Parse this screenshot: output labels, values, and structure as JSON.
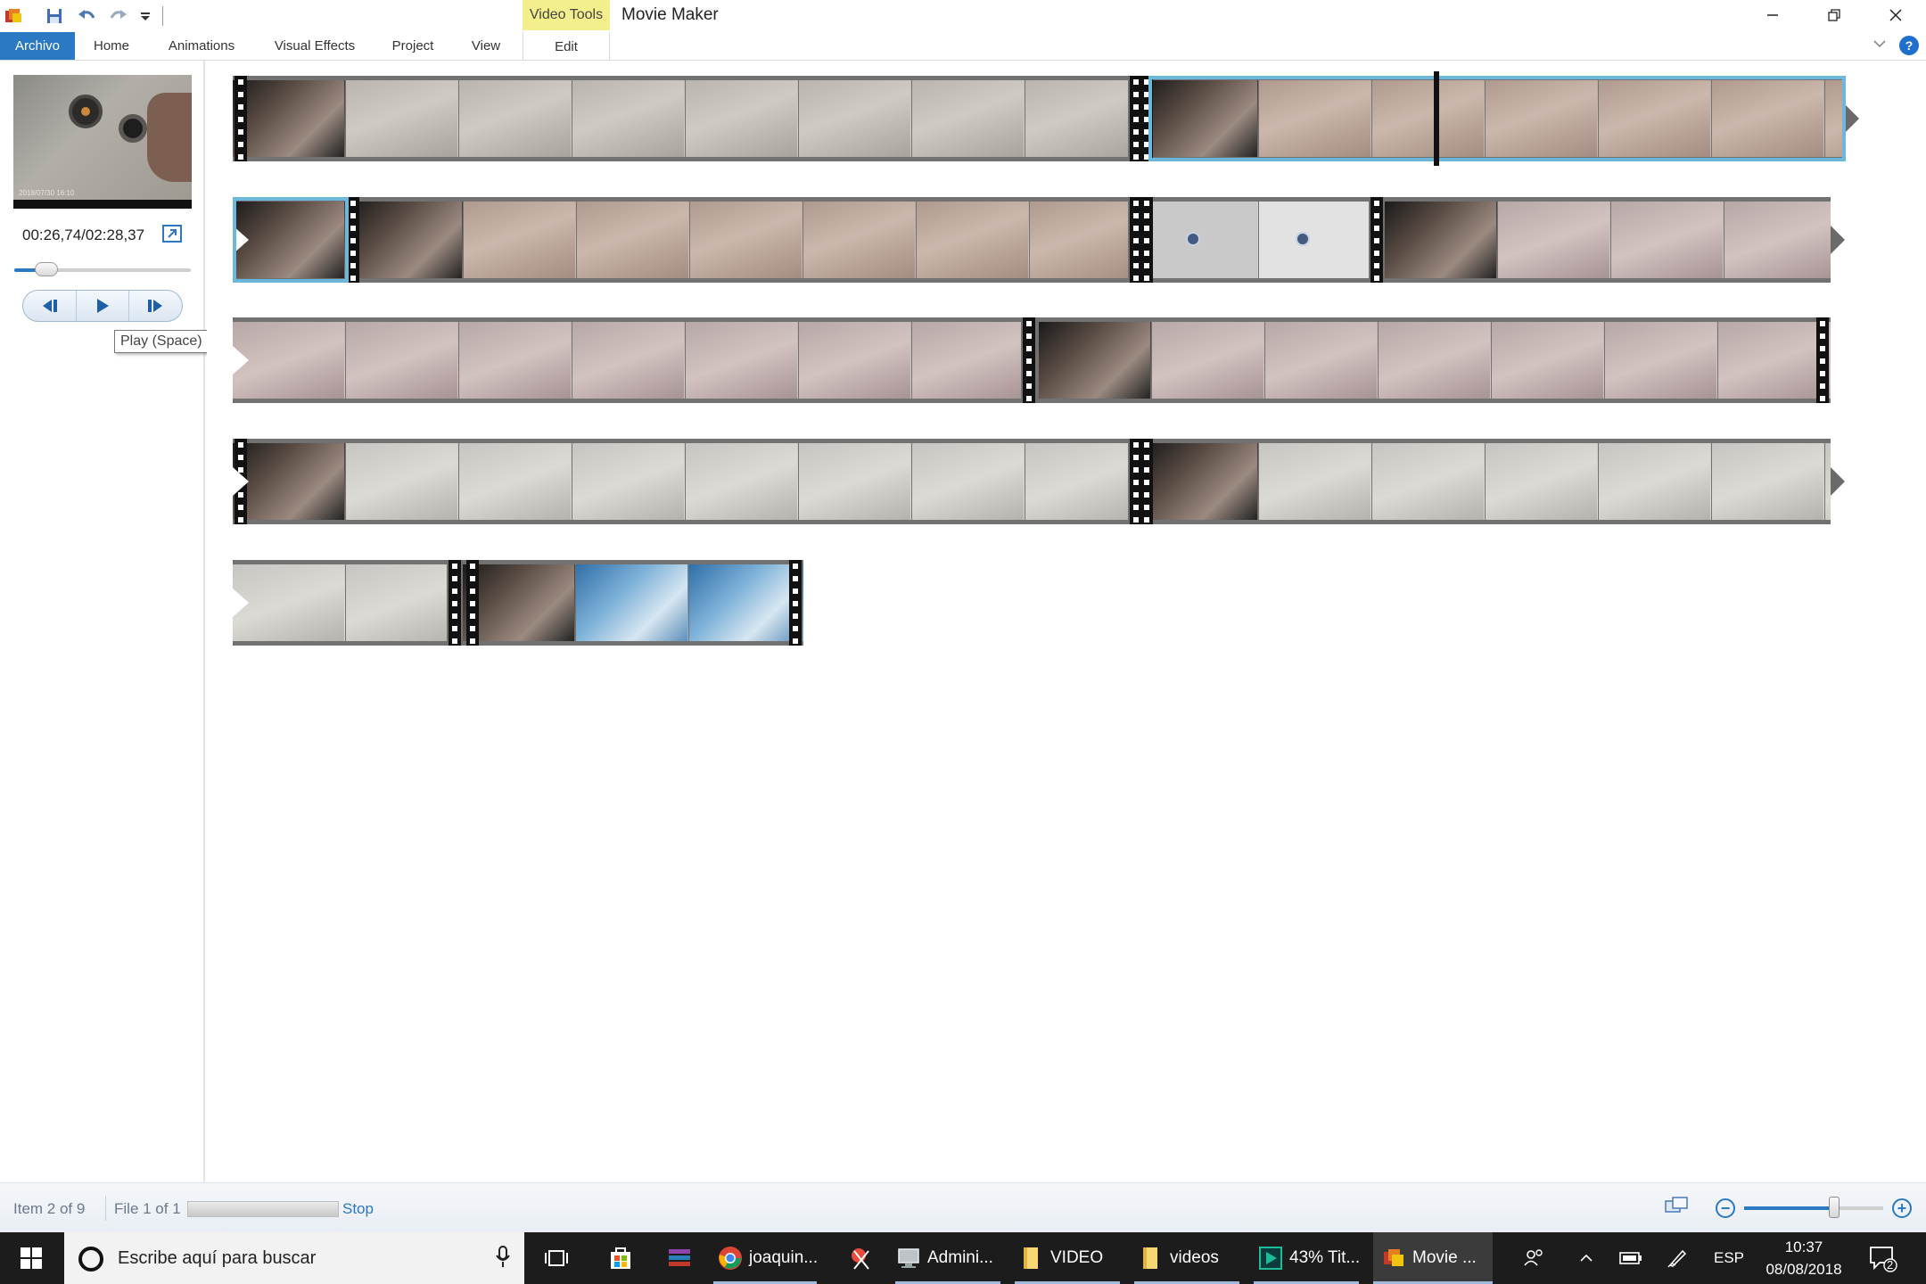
{
  "window": {
    "title": "Movie Maker",
    "contextual_tab": "Video Tools"
  },
  "ribbon": {
    "tabs": [
      "Archivo",
      "Home",
      "Animations",
      "Visual Effects",
      "Project",
      "View",
      "Edit"
    ],
    "active_tab": "Archivo",
    "help_label": "?"
  },
  "preview": {
    "timecode": "00:26,74/02:28,37",
    "tooltip": "Play (Space)",
    "seek_position_fraction": 0.18,
    "video_overlay_text": "2018/07/30  16:10"
  },
  "storyboard": {
    "rows": 5,
    "selected_item": 2
  },
  "status": {
    "item": "Item 2 of 9",
    "file": "File 1 of 1",
    "stop_label": "Stop",
    "zoom_fraction": 0.65
  },
  "taskbar": {
    "search_placeholder": "Escribe aquí para buscar",
    "apps": [
      {
        "label": "joaquin...",
        "icon": "chrome-icon"
      },
      {
        "label": "Admini...",
        "icon": "computer-admin-icon"
      },
      {
        "label": "VIDEO",
        "icon": "folder-icon"
      },
      {
        "label": "videos",
        "icon": "folder-icon"
      },
      {
        "label": "43% Tit...",
        "icon": "media-encoder-icon"
      },
      {
        "label": "Movie ...",
        "icon": "movie-maker-icon"
      }
    ],
    "language": "ESP",
    "time": "10:37",
    "date": "08/08/2018",
    "notification_count": "2"
  },
  "colors": {
    "accent": "#2b79c2",
    "contextual_tab": "#f3ef8c",
    "selection": "#6cb8dc",
    "filmstrip": "#717171",
    "taskbar": "#1c1c1c"
  }
}
